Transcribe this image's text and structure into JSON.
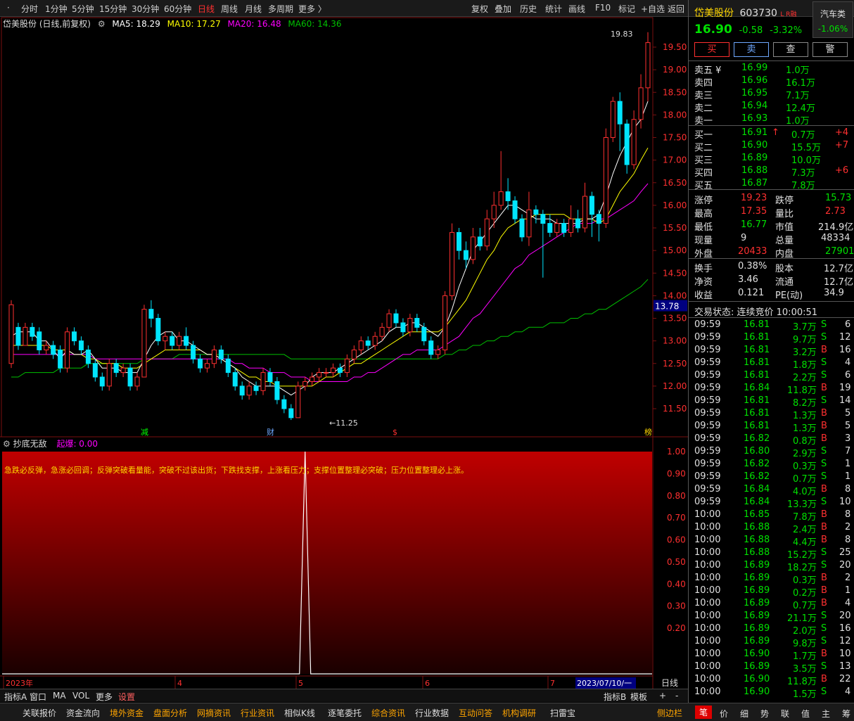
{
  "toolbar": {
    "periods": [
      "分时",
      "1分钟",
      "5分钟",
      "15分钟",
      "30分钟",
      "60分钟",
      "日线",
      "周线",
      "月线",
      "多周期",
      "更多 〉"
    ],
    "active": "日线",
    "right_buttons": [
      "复权",
      "叠加",
      "历史",
      "统计",
      "画线",
      "F10",
      "标记",
      "+自选",
      "返回"
    ]
  },
  "chart_header": {
    "name": "岱美股份 (日线,前复权)",
    "ma5": "MA5: 18.29",
    "ma10": "MA10: 17.27",
    "ma20": "MA20: 16.48",
    "ma60": "MA60: 14.36"
  },
  "colors": {
    "up": "#ff3030",
    "down": "#00e5ff",
    "ma5": "#ffffff",
    "ma10": "#ffff00",
    "ma20": "#ff00ff",
    "ma60": "#00c000"
  },
  "chart_data": {
    "type": "candlestick",
    "ylim": [
      11.2,
      19.83
    ],
    "yticks": [
      "19.50",
      "19.00",
      "18.50",
      "18.00",
      "17.50",
      "17.00",
      "16.50",
      "16.00",
      "15.50",
      "15.00",
      "14.50",
      "14.00",
      "13.50",
      "13.00",
      "12.50",
      "12.00",
      "11.50"
    ],
    "price_marker": "13.78",
    "high_label": "19.83",
    "low_label": "11.25",
    "candles": [
      [
        12.5,
        13.8,
        13.9,
        12.4
      ],
      [
        13.3,
        12.9,
        13.4,
        12.8
      ],
      [
        12.9,
        13.3,
        13.4,
        12.9
      ],
      [
        13.3,
        13.1,
        13.4,
        13.0
      ],
      [
        13.2,
        12.8,
        13.3,
        12.7
      ],
      [
        12.8,
        12.9,
        13.0,
        12.7
      ],
      [
        12.9,
        12.7,
        13.0,
        12.6
      ],
      [
        12.8,
        12.4,
        12.9,
        12.3
      ],
      [
        12.4,
        13.2,
        13.3,
        12.3
      ],
      [
        13.2,
        13.0,
        13.3,
        12.9
      ],
      [
        13.0,
        12.8,
        13.1,
        12.7
      ],
      [
        12.8,
        12.5,
        12.9,
        12.4
      ],
      [
        12.5,
        12.2,
        12.6,
        12.1
      ],
      [
        12.2,
        12.0,
        12.3,
        11.9
      ],
      [
        12.0,
        12.5,
        12.6,
        11.9
      ],
      [
        12.5,
        12.3,
        12.6,
        12.2
      ],
      [
        12.3,
        12.4,
        12.5,
        12.2
      ],
      [
        12.4,
        12.0,
        12.5,
        11.9
      ],
      [
        12.0,
        12.2,
        12.3,
        11.9
      ],
      [
        12.2,
        13.7,
        13.8,
        12.2
      ],
      [
        13.7,
        13.5,
        13.9,
        13.3
      ],
      [
        13.5,
        13.0,
        13.6,
        12.9
      ],
      [
        13.0,
        13.1,
        13.2,
        12.8
      ],
      [
        13.1,
        12.9,
        13.2,
        12.8
      ],
      [
        12.9,
        13.1,
        13.2,
        12.8
      ],
      [
        13.1,
        12.9,
        13.3,
        12.8
      ],
      [
        12.9,
        12.6,
        13.0,
        12.5
      ],
      [
        12.6,
        12.4,
        12.7,
        12.3
      ],
      [
        12.4,
        12.5,
        12.6,
        12.3
      ],
      [
        12.5,
        12.8,
        12.9,
        12.4
      ],
      [
        12.8,
        12.6,
        12.9,
        12.5
      ],
      [
        12.6,
        12.3,
        12.7,
        12.2
      ],
      [
        12.3,
        12.0,
        12.4,
        11.9
      ],
      [
        12.0,
        11.8,
        12.1,
        11.7
      ],
      [
        11.8,
        12.0,
        12.1,
        11.7
      ],
      [
        12.0,
        11.9,
        12.1,
        11.8
      ],
      [
        11.9,
        12.3,
        12.4,
        11.8
      ],
      [
        12.3,
        12.1,
        12.4,
        12.0
      ],
      [
        12.1,
        11.7,
        12.2,
        11.6
      ],
      [
        11.7,
        11.5,
        11.8,
        11.4
      ],
      [
        11.5,
        11.3,
        11.6,
        11.25
      ],
      [
        11.3,
        12.0,
        12.1,
        11.3
      ],
      [
        12.0,
        12.1,
        12.2,
        11.9
      ],
      [
        12.1,
        12.2,
        12.3,
        12.0
      ],
      [
        12.2,
        12.3,
        12.4,
        12.1
      ],
      [
        12.3,
        12.3,
        12.4,
        12.2
      ],
      [
        12.3,
        12.4,
        12.5,
        12.2
      ],
      [
        12.4,
        12.3,
        12.5,
        12.2
      ],
      [
        12.3,
        12.6,
        12.7,
        12.2
      ],
      [
        12.6,
        12.8,
        12.9,
        12.5
      ],
      [
        12.8,
        13.0,
        13.1,
        12.7
      ],
      [
        13.0,
        12.9,
        13.1,
        12.8
      ],
      [
        12.9,
        13.1,
        13.2,
        12.8
      ],
      [
        13.1,
        13.3,
        13.4,
        13.0
      ],
      [
        13.3,
        13.6,
        13.7,
        13.2
      ],
      [
        13.6,
        13.4,
        13.7,
        13.3
      ],
      [
        13.4,
        13.2,
        13.5,
        13.1
      ],
      [
        13.2,
        13.5,
        13.6,
        13.1
      ],
      [
        13.5,
        13.3,
        13.6,
        13.2
      ],
      [
        13.3,
        13.0,
        13.4,
        12.9
      ],
      [
        13.0,
        12.7,
        13.1,
        12.6
      ],
      [
        12.7,
        12.8,
        12.9,
        12.6
      ],
      [
        12.8,
        14.0,
        14.1,
        12.7
      ],
      [
        14.0,
        15.4,
        15.6,
        13.9
      ],
      [
        15.4,
        15.0,
        15.5,
        14.8
      ],
      [
        15.0,
        14.8,
        15.2,
        14.6
      ],
      [
        14.8,
        15.3,
        15.5,
        14.7
      ],
      [
        15.3,
        15.1,
        15.5,
        15.0
      ],
      [
        15.1,
        15.7,
        15.9,
        15.0
      ],
      [
        15.7,
        16.0,
        16.3,
        15.5
      ],
      [
        16.0,
        16.3,
        17.2,
        15.9
      ],
      [
        16.3,
        16.1,
        16.6,
        15.9
      ],
      [
        16.1,
        15.7,
        16.2,
        15.6
      ],
      [
        15.7,
        15.3,
        15.8,
        15.2
      ],
      [
        15.3,
        15.9,
        16.3,
        15.1
      ],
      [
        15.9,
        15.8,
        16.0,
        15.6
      ],
      [
        15.8,
        15.6,
        15.9,
        14.4
      ],
      [
        15.6,
        15.4,
        15.8,
        15.3
      ],
      [
        15.4,
        15.6,
        15.7,
        15.3
      ],
      [
        15.6,
        15.4,
        15.7,
        15.3
      ],
      [
        15.4,
        15.7,
        16.0,
        15.3
      ],
      [
        15.7,
        15.5,
        15.9,
        15.4
      ],
      [
        15.5,
        16.2,
        16.5,
        15.4
      ],
      [
        16.2,
        15.8,
        16.3,
        15.3
      ],
      [
        15.8,
        15.6,
        15.9,
        15.2
      ],
      [
        15.6,
        17.5,
        17.7,
        15.5
      ],
      [
        17.5,
        18.3,
        18.4,
        17.4
      ],
      [
        18.3,
        17.8,
        18.5,
        17.2
      ],
      [
        17.8,
        16.9,
        17.9,
        16.7
      ],
      [
        16.9,
        17.9,
        18.1,
        16.8
      ],
      [
        17.9,
        18.6,
        18.9,
        17.7
      ],
      [
        18.6,
        19.6,
        19.83,
        18.3
      ]
    ],
    "ma5": [
      13.1,
      13.2,
      13.2,
      13.2,
      13.0,
      13.0,
      12.8,
      12.6,
      12.8,
      12.7,
      12.7,
      12.8,
      12.6,
      12.4,
      12.4,
      12.4,
      12.3,
      12.3,
      12.3,
      12.6,
      12.9,
      13.1,
      13.2,
      13.2,
      13.0,
      13.0,
      12.9,
      12.8,
      12.7,
      12.7,
      12.6,
      12.5,
      12.4,
      12.2,
      12.1,
      12.0,
      12.0,
      12.0,
      12.0,
      11.9,
      11.8,
      11.9,
      12.0,
      12.2,
      12.3,
      12.3,
      12.3,
      12.4,
      12.5,
      12.6,
      12.7,
      12.8,
      12.9,
      13.0,
      13.2,
      13.3,
      13.3,
      13.4,
      13.4,
      13.3,
      13.2,
      13.1,
      13.3,
      13.7,
      14.2,
      14.6,
      15.0,
      15.2,
      15.4,
      15.6,
      15.8,
      16.0,
      16.0,
      15.9,
      15.8,
      15.7,
      15.7,
      15.7,
      15.6,
      15.6,
      15.6,
      15.6,
      15.7,
      15.7,
      15.8,
      16.2,
      16.7,
      17.1,
      17.4,
      17.7,
      17.9,
      18.3
    ],
    "ma10": [
      12.9,
      12.9,
      12.9,
      12.9,
      12.9,
      12.9,
      12.8,
      12.8,
      12.8,
      12.7,
      12.7,
      12.6,
      12.6,
      12.5,
      12.5,
      12.5,
      12.4,
      12.4,
      12.4,
      12.5,
      12.6,
      12.7,
      12.8,
      12.8,
      12.8,
      12.8,
      12.8,
      12.8,
      12.7,
      12.7,
      12.6,
      12.5,
      12.4,
      12.3,
      12.2,
      12.2,
      12.1,
      12.1,
      12.0,
      12.0,
      12.0,
      12.0,
      12.0,
      12.0,
      12.1,
      12.2,
      12.2,
      12.3,
      12.4,
      12.5,
      12.5,
      12.6,
      12.7,
      12.8,
      12.9,
      13.0,
      13.1,
      13.2,
      13.2,
      13.2,
      13.2,
      13.2,
      13.3,
      13.5,
      13.7,
      13.9,
      14.2,
      14.5,
      14.8,
      15.0,
      15.3,
      15.5,
      15.6,
      15.7,
      15.7,
      15.8,
      15.8,
      15.8,
      15.8,
      15.8,
      15.7,
      15.7,
      15.7,
      15.7,
      15.6,
      15.7,
      16.0,
      16.3,
      16.5,
      16.7,
      17.0,
      17.27
    ],
    "ma20": [
      12.7,
      12.7,
      12.7,
      12.7,
      12.7,
      12.7,
      12.7,
      12.7,
      12.7,
      12.7,
      12.7,
      12.7,
      12.6,
      12.6,
      12.6,
      12.6,
      12.6,
      12.6,
      12.6,
      12.6,
      12.6,
      12.6,
      12.6,
      12.6,
      12.6,
      12.6,
      12.6,
      12.6,
      12.6,
      12.6,
      12.6,
      12.6,
      12.5,
      12.5,
      12.4,
      12.4,
      12.4,
      12.3,
      12.3,
      12.3,
      12.2,
      12.2,
      12.2,
      12.1,
      12.1,
      12.1,
      12.1,
      12.1,
      12.1,
      12.2,
      12.2,
      12.3,
      12.3,
      12.4,
      12.5,
      12.6,
      12.7,
      12.7,
      12.8,
      12.8,
      12.8,
      12.8,
      12.9,
      13.0,
      13.1,
      13.3,
      13.5,
      13.6,
      13.8,
      14.0,
      14.2,
      14.4,
      14.6,
      14.7,
      14.9,
      15.0,
      15.1,
      15.2,
      15.3,
      15.4,
      15.5,
      15.6,
      15.6,
      15.6,
      15.7,
      15.7,
      15.8,
      15.9,
      16.0,
      16.1,
      16.3,
      16.48
    ],
    "ma60": [
      12.2,
      12.2,
      12.3,
      12.3,
      12.3,
      12.3,
      12.3,
      12.4,
      12.4,
      12.4,
      12.4,
      12.5,
      12.5,
      12.5,
      12.5,
      12.5,
      12.5,
      12.5,
      12.5,
      12.6,
      12.6,
      12.6,
      12.6,
      12.6,
      12.7,
      12.7,
      12.7,
      12.7,
      12.7,
      12.7,
      12.7,
      12.7,
      12.7,
      12.7,
      12.7,
      12.7,
      12.7,
      12.7,
      12.7,
      12.7,
      12.6,
      12.6,
      12.6,
      12.6,
      12.6,
      12.6,
      12.6,
      12.6,
      12.6,
      12.6,
      12.6,
      12.6,
      12.6,
      12.6,
      12.6,
      12.6,
      12.6,
      12.6,
      12.6,
      12.6,
      12.6,
      12.6,
      12.7,
      12.7,
      12.8,
      12.8,
      12.9,
      12.9,
      13.0,
      13.0,
      13.1,
      13.1,
      13.2,
      13.2,
      13.3,
      13.3,
      13.3,
      13.4,
      13.4,
      13.4,
      13.5,
      13.5,
      13.6,
      13.6,
      13.7,
      13.7,
      13.8,
      13.9,
      14.0,
      14.1,
      14.2,
      14.36
    ]
  },
  "markers": [
    {
      "i": 19,
      "t": "减",
      "c": "#00ff00"
    },
    {
      "i": 37,
      "t": "财",
      "c": "#6fa8ff"
    },
    {
      "i": 55,
      "t": "$",
      "c": "#ff3030"
    },
    {
      "i": 91,
      "t": "榜",
      "c": "#ffd700"
    }
  ],
  "indicator": {
    "name": "抄底无敌",
    "value": "起爆: 0.00",
    "text": "急跌必反弹，急涨必回调；反弹突破看量能，突破不过该出货；下跌找支撑，上涨看压力；支撑位置整理必突破；压力位置整理必上涨。",
    "yticks": [
      "1.00",
      "0.90",
      "0.80",
      "0.70",
      "0.60",
      "0.50",
      "0.40",
      "0.30",
      "0.20"
    ],
    "spike_index": 42
  },
  "xaxis": {
    "labels": [
      "2023年",
      "4",
      "5",
      "6",
      "7"
    ],
    "date": "2023/07/10/一",
    "period": "日线"
  },
  "bottom_tabs": [
    "指标A",
    "窗口",
    "MA",
    "VOL",
    "更多",
    "设置"
  ],
  "bottom_right": [
    "指标B",
    "模板",
    "+",
    "-"
  ],
  "footer_left": [
    "关联报价",
    "资金流向",
    "境外资金",
    "盘面分析",
    "网摘资讯",
    "行业资讯",
    "相似K线",
    "逐笔委托",
    "综合资讯",
    "行业数据",
    "互动问答",
    "机构调研",
    "扫雷宝"
  ],
  "footer_right_side": "侧边栏",
  "footer_tabs": [
    "笔",
    "价",
    "细",
    "势",
    "联",
    "值",
    "主",
    "筹"
  ],
  "stock": {
    "name": "岱美股份",
    "code": "603730",
    "tag": "L R",
    "tag2": "融",
    "sector": "汽车类",
    "sector_change": "-1.06%",
    "price": "16.90",
    "change": "-0.58",
    "pct": "-3.32%"
  },
  "actions": [
    "买",
    "卖",
    "查",
    "警"
  ],
  "asks": [
    [
      "卖五 ¥",
      "16.99",
      "1.0万"
    ],
    [
      "卖四",
      "16.96",
      "16.1万"
    ],
    [
      "卖三",
      "16.95",
      "7.1万"
    ],
    [
      "卖二",
      "16.94",
      "12.4万"
    ],
    [
      "卖一",
      "16.93",
      "1.0万"
    ]
  ],
  "bids": [
    [
      "买一",
      "16.91",
      "0.7万",
      "+4"
    ],
    [
      "买二",
      "16.90",
      "15.5万",
      "+7"
    ],
    [
      "买三",
      "16.89",
      "10.0万",
      ""
    ],
    [
      "买四",
      "16.88",
      "7.3万",
      "+6"
    ],
    [
      "买五",
      "16.87",
      "7.8万",
      ""
    ]
  ],
  "stats": [
    [
      "涨停",
      "19.23",
      "跌停",
      "15.73"
    ],
    [
      "最高",
      "17.35",
      "量比",
      "2.73"
    ],
    [
      "最低",
      "16.77",
      "市值",
      "214.9亿"
    ],
    [
      "现量",
      "9",
      "总量",
      "48334"
    ],
    [
      "外盘",
      "20433",
      "内盘",
      "27901"
    ]
  ],
  "stats2": [
    [
      "换手",
      "0.38%",
      "股本",
      "12.7亿"
    ],
    [
      "净资",
      "3.46",
      "流通",
      "12.7亿"
    ],
    [
      "收益",
      "0.121",
      "PE(动)",
      "34.9"
    ]
  ],
  "status": "交易状态: 连续竞价 10:00:51",
  "ticks": [
    [
      "09:59",
      "16.81",
      "3.7万",
      "S",
      "6"
    ],
    [
      "09:59",
      "16.81",
      "9.7万",
      "S",
      "12"
    ],
    [
      "09:59",
      "16.81",
      "3.2万",
      "B",
      "16"
    ],
    [
      "09:59",
      "16.81",
      "1.8万",
      "S",
      "4"
    ],
    [
      "09:59",
      "16.81",
      "2.2万",
      "S",
      "6"
    ],
    [
      "09:59",
      "16.84",
      "11.8万",
      "B",
      "19"
    ],
    [
      "09:59",
      "16.81",
      "8.2万",
      "S",
      "14"
    ],
    [
      "09:59",
      "16.81",
      "1.3万",
      "B",
      "5"
    ],
    [
      "09:59",
      "16.81",
      "1.3万",
      "B",
      "5"
    ],
    [
      "09:59",
      "16.82",
      "0.8万",
      "B",
      "3"
    ],
    [
      "09:59",
      "16.80",
      "2.9万",
      "S",
      "7"
    ],
    [
      "09:59",
      "16.82",
      "0.3万",
      "S",
      "1"
    ],
    [
      "09:59",
      "16.82",
      "0.7万",
      "S",
      "1"
    ],
    [
      "09:59",
      "16.84",
      "4.0万",
      "B",
      "8"
    ],
    [
      "09:59",
      "16.84",
      "13.3万",
      "S",
      "10"
    ],
    [
      "10:00",
      "16.85",
      "7.8万",
      "B",
      "8"
    ],
    [
      "10:00",
      "16.88",
      "2.4万",
      "B",
      "2"
    ],
    [
      "10:00",
      "16.88",
      "4.4万",
      "B",
      "8"
    ],
    [
      "10:00",
      "16.88",
      "15.2万",
      "S",
      "25"
    ],
    [
      "10:00",
      "16.89",
      "18.2万",
      "S",
      "20"
    ],
    [
      "10:00",
      "16.89",
      "0.3万",
      "B",
      "2"
    ],
    [
      "10:00",
      "16.89",
      "0.2万",
      "B",
      "1"
    ],
    [
      "10:00",
      "16.89",
      "0.7万",
      "B",
      "4"
    ],
    [
      "10:00",
      "16.89",
      "21.1万",
      "S",
      "20"
    ],
    [
      "10:00",
      "16.89",
      "2.0万",
      "S",
      "16"
    ],
    [
      "10:00",
      "16.89",
      "9.8万",
      "S",
      "12"
    ],
    [
      "10:00",
      "16.90",
      "1.7万",
      "B",
      "10"
    ],
    [
      "10:00",
      "16.89",
      "3.5万",
      "S",
      "13"
    ],
    [
      "10:00",
      "16.90",
      "11.8万",
      "B",
      "22"
    ],
    [
      "10:00",
      "16.90",
      "1.5万",
      "S",
      "4"
    ]
  ]
}
